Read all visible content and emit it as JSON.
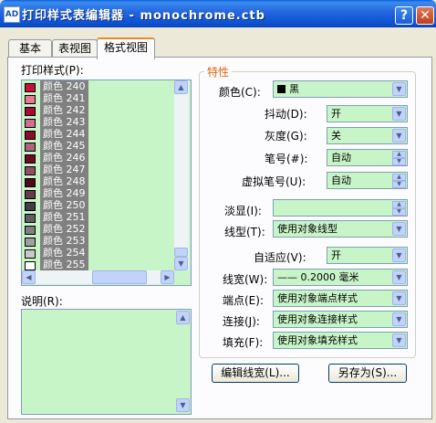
{
  "window": {
    "title": "打印样式表编辑器 - monochrome.ctb",
    "app_icon_text": "AD"
  },
  "tabs": [
    "基本",
    "表视图",
    "格式视图"
  ],
  "left": {
    "styles_label": "打印样式(P):",
    "description_label": "说明(R):",
    "items": [
      {
        "label": "颜色 240",
        "color": "#c8103c"
      },
      {
        "label": "颜色 241",
        "color": "#e8798f"
      },
      {
        "label": "颜色 242",
        "color": "#a80c30"
      },
      {
        "label": "颜色 243",
        "color": "#d0708a"
      },
      {
        "label": "颜色 244",
        "color": "#8a0c28"
      },
      {
        "label": "颜色 245",
        "color": "#b06478"
      },
      {
        "label": "颜色 246",
        "color": "#700a20"
      },
      {
        "label": "颜色 247",
        "color": "#905060"
      },
      {
        "label": "颜色 248",
        "color": "#500818"
      },
      {
        "label": "颜色 249",
        "color": "#6a3a48"
      },
      {
        "label": "颜色 250",
        "color": "#404040"
      },
      {
        "label": "颜色 251",
        "color": "#606060"
      },
      {
        "label": "颜色 252",
        "color": "#808080"
      },
      {
        "label": "颜色 253",
        "color": "#a0a0a0"
      },
      {
        "label": "颜色 254",
        "color": "#c8c8c8"
      },
      {
        "label": "颜色 255",
        "color": "#ffffff"
      }
    ]
  },
  "props": {
    "group_title": "特性",
    "color_label": "颜色(C):",
    "color_value": "黑",
    "dither_label": "抖动(D):",
    "dither_value": "开",
    "grayscale_label": "灰度(G):",
    "grayscale_value": "关",
    "pen_label": "笔号(#):",
    "pen_value": "自动",
    "vpen_label": "虚拟笔号(U):",
    "vpen_value": "自动",
    "screening_label": "淡显(I):",
    "screening_value": "",
    "linetype_label": "线型(T):",
    "linetype_value": "使用对象线型",
    "adaptive_label": "自适应(V):",
    "adaptive_value": "开",
    "lineweight_label": "线宽(W):",
    "lineweight_value": "—— 0.2000 毫米",
    "endstyle_label": "端点(E):",
    "endstyle_value": "使用对象端点样式",
    "joinstyle_label": "连接(J):",
    "joinstyle_value": "使用对象连接样式",
    "fillstyle_label": "填充(F):",
    "fillstyle_value": "使用对象填充样式"
  },
  "buttons": {
    "edit_lineweights": "编辑线宽(L)...",
    "save_as": "另存为(S)..."
  }
}
